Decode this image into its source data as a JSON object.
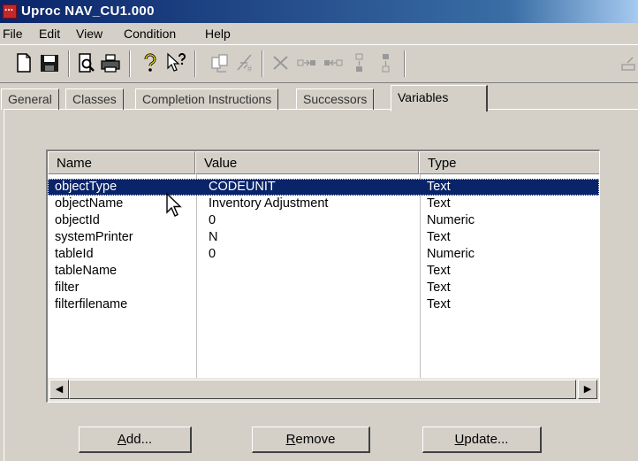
{
  "window": {
    "title": "Uproc NAV_CU1.000"
  },
  "menu": [
    "File",
    "Edit",
    "View",
    "Condition",
    "Help"
  ],
  "toolbar": {
    "icons": [
      "new-icon",
      "save-icon",
      "print-preview-icon",
      "print-icon",
      "help-icon",
      "context-help-icon",
      "copy-icon",
      "edit-icon",
      "delete-icon",
      "move-right-icon",
      "move-left-icon",
      "move-up-icon",
      "move-down-icon",
      "export-icon"
    ]
  },
  "tabs": [
    {
      "label": "General",
      "active": false
    },
    {
      "label": "Classes",
      "active": false
    },
    {
      "label": "Completion Instructions",
      "active": false
    },
    {
      "label": "Successors",
      "active": false
    },
    {
      "label": "Variables",
      "active": true
    }
  ],
  "variables": {
    "columns": [
      "Name",
      "Value",
      "Type"
    ],
    "rows": [
      {
        "name": "objectType",
        "value": "CODEUNIT",
        "type": "Text",
        "selected": true
      },
      {
        "name": "objectName",
        "value": "Inventory Adjustment",
        "type": "Text"
      },
      {
        "name": "objectId",
        "value": "0",
        "type": "Numeric"
      },
      {
        "name": "systemPrinter",
        "value": "N",
        "type": "Text"
      },
      {
        "name": "tableId",
        "value": "0",
        "type": "Numeric"
      },
      {
        "name": "tableName",
        "value": "",
        "type": "Text"
      },
      {
        "name": "filter",
        "value": "",
        "type": "Text"
      },
      {
        "name": "filterfilename",
        "value": "",
        "type": "Text"
      }
    ]
  },
  "buttons": {
    "add": {
      "mnemonic": "A",
      "rest": "dd..."
    },
    "remove": {
      "mnemonic": "R",
      "rest": "emove"
    },
    "update": {
      "mnemonic": "U",
      "rest": "pdate..."
    }
  },
  "colors": {
    "title_bar": "#0a246a",
    "selection": "#0a246a",
    "face": "#d4d0c8"
  }
}
